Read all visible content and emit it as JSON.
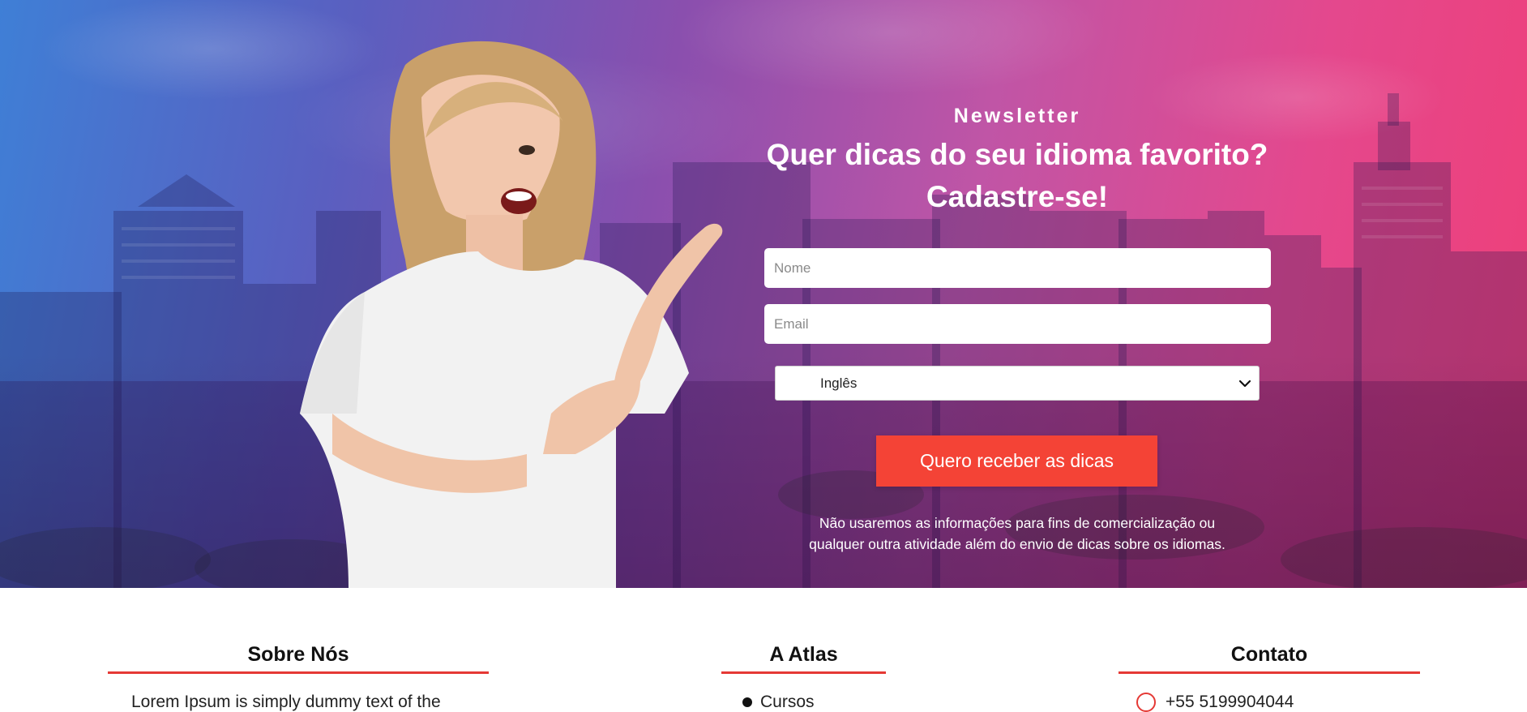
{
  "newsletter": {
    "eyebrow": "Newsletter",
    "headline_line1": "Quer dicas do seu idioma favorito?",
    "headline_line2": "Cadastre-se!",
    "name_placeholder": "Nome",
    "email_placeholder": "Email",
    "language_selected": "Inglês",
    "submit_label": "Quero receber as dicas",
    "disclaimer_line1": "Não usaremos as informações para fins de comercialização ou",
    "disclaimer_line2": "qualquer outra atividade além do envio de dicas sobre os idiomas."
  },
  "footer": {
    "about_title": "Sobre Nós",
    "about_text": "Lorem Ipsum is simply dummy text of the",
    "atlas_title": "A Atlas",
    "atlas_first_item": "Cursos",
    "contact_title": "Contato",
    "contact_phone": "+55 5199904044"
  },
  "colors": {
    "accent": "#f44336",
    "underline": "#e53935",
    "gradient_left": "#3f7fd6",
    "gradient_right": "#ef3f78"
  },
  "icons": {
    "chevron": "chevron-down-icon",
    "phone": "phone-icon"
  }
}
